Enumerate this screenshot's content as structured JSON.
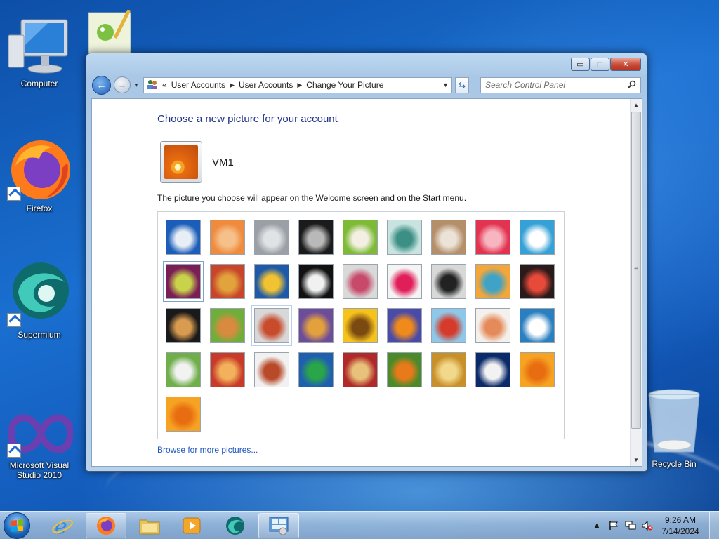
{
  "desktop": {
    "icons": [
      {
        "label": "Computer"
      },
      {
        "label": "Firefox"
      },
      {
        "label": "Supermium"
      },
      {
        "label": "Microsoft Visual Studio 2010"
      },
      {
        "label": "Recycle Bin"
      }
    ]
  },
  "window": {
    "controls": {
      "minimize": "▭",
      "maximize": "◻",
      "close": "✕"
    },
    "address": {
      "prefix": "«",
      "crumbs": [
        "User Accounts",
        "User Accounts",
        "Change Your Picture"
      ]
    },
    "search": {
      "placeholder": "Search Control Panel"
    },
    "heading": "Choose a new picture for your account",
    "account_name": "VM1",
    "description": "The picture you choose will appear on the Welcome screen and on the Start menu.",
    "browse_link": "Browse for more pictures...",
    "pictures": [
      {
        "name": "roller-coaster",
        "colors": [
          "#1b5db8",
          "#e7eef6"
        ]
      },
      {
        "name": "starfish",
        "colors": [
          "#f08a3c",
          "#f5c08a"
        ]
      },
      {
        "name": "robot-bunny",
        "colors": [
          "#9aa0a6",
          "#e0e3e6"
        ]
      },
      {
        "name": "record-player",
        "colors": [
          "#1b1b1b",
          "#b9b9b9"
        ]
      },
      {
        "name": "lucky-cat",
        "colors": [
          "#7dbb36",
          "#f4efe2"
        ]
      },
      {
        "name": "gyroscope",
        "colors": [
          "#c8e3e0",
          "#3c8f85"
        ]
      },
      {
        "name": "cat",
        "colors": [
          "#b58f6a",
          "#ece3d8"
        ]
      },
      {
        "name": "flower",
        "colors": [
          "#e23350",
          "#f7b5c0"
        ]
      },
      {
        "name": "pinwheel",
        "colors": [
          "#36a1d6",
          "#ffffff"
        ]
      },
      {
        "name": "ball",
        "colors": [
          "#7a1f55",
          "#c8d34a"
        ]
      },
      {
        "name": "fabric",
        "colors": [
          "#c8452b",
          "#e2a33c"
        ]
      },
      {
        "name": "leaf",
        "colors": [
          "#1e5aa8",
          "#f1c232"
        ]
      },
      {
        "name": "dog",
        "colors": [
          "#111111",
          "#f1f1f1"
        ]
      },
      {
        "name": "crayons",
        "colors": [
          "#d9d9d9",
          "#c84a6a"
        ]
      },
      {
        "name": "star",
        "colors": [
          "#f4f4f4",
          "#e01e5a"
        ]
      },
      {
        "name": "jacks",
        "colors": [
          "#d8d8d8",
          "#222222"
        ]
      },
      {
        "name": "stairs",
        "colors": [
          "#f3a63a",
          "#3fa3c8"
        ]
      },
      {
        "name": "origami",
        "colors": [
          "#2a1a1a",
          "#e84a3a"
        ]
      },
      {
        "name": "guitar",
        "colors": [
          "#1a1a1a",
          "#d99b4f"
        ]
      },
      {
        "name": "puppy",
        "colors": [
          "#6fae3b",
          "#d98a3f"
        ]
      },
      {
        "name": "robot",
        "colors": [
          "#d8d8d8",
          "#c84b2c"
        ]
      },
      {
        "name": "scarves",
        "colors": [
          "#6d4c9a",
          "#e2a13d"
        ]
      },
      {
        "name": "sunflower",
        "colors": [
          "#f6c21c",
          "#7a4a12"
        ]
      },
      {
        "name": "fish",
        "colors": [
          "#4a4aa8",
          "#f08a1a"
        ]
      },
      {
        "name": "balloon",
        "colors": [
          "#8fc7e8",
          "#d63a2a"
        ]
      },
      {
        "name": "doll",
        "colors": [
          "#f4f1ec",
          "#e58a5a"
        ]
      },
      {
        "name": "sailboat",
        "colors": [
          "#2a7fc0",
          "#ffffff"
        ]
      },
      {
        "name": "soccer-ball",
        "colors": [
          "#6fae4a",
          "#f2f2f2"
        ]
      },
      {
        "name": "textile",
        "colors": [
          "#c83a2a",
          "#f2b15a"
        ]
      },
      {
        "name": "marbles",
        "colors": [
          "#f1f1f1",
          "#b84a2a"
        ]
      },
      {
        "name": "window",
        "colors": [
          "#1f5fb0",
          "#2aa54a"
        ]
      },
      {
        "name": "rug",
        "colors": [
          "#b02a2a",
          "#e8c27a"
        ]
      },
      {
        "name": "butterfly",
        "colors": [
          "#4a8a2a",
          "#e87a1a"
        ]
      },
      {
        "name": "shell",
        "colors": [
          "#c8902a",
          "#f2d88a"
        ]
      },
      {
        "name": "lighthouse",
        "colors": [
          "#0a2a6a",
          "#f2f2f2"
        ]
      },
      {
        "name": "daisy",
        "colors": [
          "#f6a323",
          "#e86d11"
        ]
      },
      {
        "name": "gerbera",
        "colors": [
          "#f6a323",
          "#e86d11"
        ]
      }
    ],
    "selected_picture": 9,
    "hovered_picture": 20
  },
  "taskbar": {
    "apps": [
      "internet-explorer",
      "firefox",
      "explorer",
      "media-player",
      "supermium",
      "control-panel"
    ],
    "clock": {
      "time": "9:26 AM",
      "date": "7/14/2024"
    }
  }
}
